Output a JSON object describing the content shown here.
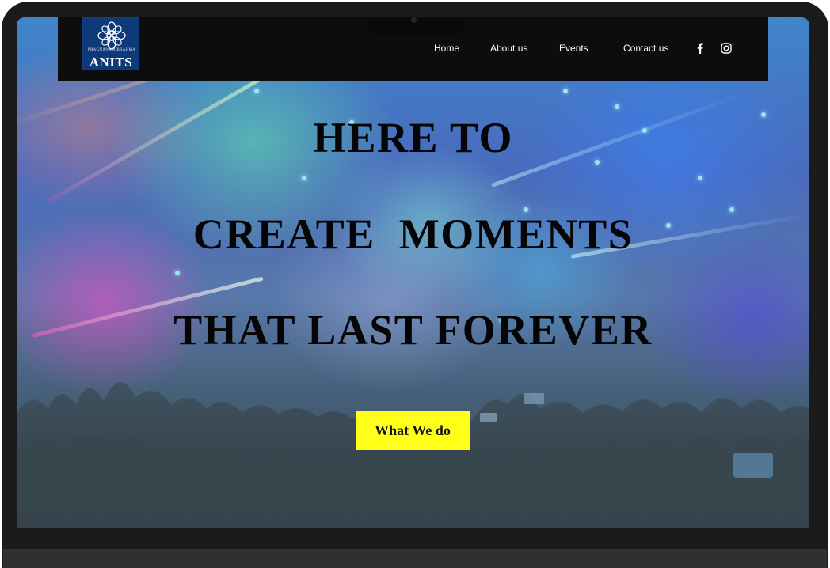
{
  "logo": {
    "text": "ANITS",
    "tagline": "PRAGNANAM BRAHMA"
  },
  "nav": {
    "home": "Home",
    "about": "About us",
    "events": "Events",
    "contact": "Contact us"
  },
  "social": {
    "facebook_icon": "facebook-icon",
    "instagram_icon": "instagram-icon"
  },
  "hero": {
    "line1": "HERE TO",
    "line2": "CREATE  MOMENTS",
    "line3": "THAT LAST FOREVER",
    "cta_label": "What We do"
  },
  "colors": {
    "header_bg": "#0d0d0e",
    "cta_bg": "#ffff1a",
    "headline": "#050505",
    "logo_bg": "#0f3a7a"
  }
}
